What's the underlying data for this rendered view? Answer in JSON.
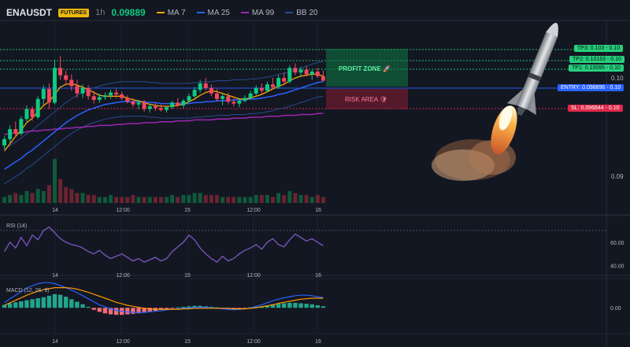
{
  "header": {
    "symbol": "ENAUSDT",
    "market_badge": "FUTURES",
    "timeframe": "1h",
    "last_price": "0.09889",
    "legend": [
      {
        "label": "MA 7",
        "color": "#f7a600"
      },
      {
        "label": "MA 25",
        "color": "#2962ff"
      },
      {
        "label": "MA 99",
        "color": "#9c27b0"
      },
      {
        "label": "BB 20",
        "color": "#2a4a8f"
      }
    ]
  },
  "colors": {
    "up": "#0ecb81",
    "down": "#f6465d",
    "bg": "#131722",
    "tp": "#26d07c",
    "entry": "#2962ff",
    "sl": "#e0294a"
  },
  "zones": {
    "profit_label": "PROFIT ZONE 🚀",
    "risk_label": "RISK AREA 🛡"
  },
  "levels": {
    "tp3": "TP3: 0.103 - 0.10",
    "tp2": "TP2: 0.10163 - 0.10",
    "tp1": "TP1: 0.10095 - 0.10",
    "entry": "ENTRY: 0.098896 - 0.10",
    "sl": "SL: 0.096844 - 0.10"
  },
  "price_axis_labels": [
    "0.10",
    "0.09"
  ],
  "rocket_icon": "rocket-launch",
  "chart_data": [
    {
      "type": "candlestick",
      "x_ticks": [
        "14",
        "12:00",
        "15",
        "12:00",
        "16"
      ],
      "y_ticks": [
        0.09,
        0.1
      ],
      "ylim": [
        0.0855,
        0.1055
      ],
      "candles": [
        [
          0.0918,
          0.0928,
          0.0914,
          0.0925
        ],
        [
          0.0925,
          0.094,
          0.0921,
          0.0936
        ],
        [
          0.0936,
          0.0944,
          0.0927,
          0.0931
        ],
        [
          0.0931,
          0.095,
          0.0929,
          0.0947
        ],
        [
          0.0947,
          0.0962,
          0.0944,
          0.0958
        ],
        [
          0.0958,
          0.0961,
          0.0945,
          0.0949
        ],
        [
          0.0949,
          0.0972,
          0.0947,
          0.0969
        ],
        [
          0.0969,
          0.0984,
          0.0963,
          0.098
        ],
        [
          0.098,
          0.0986,
          0.0958,
          0.0965
        ],
        [
          0.0965,
          0.1012,
          0.0963,
          0.1003
        ],
        [
          0.1003,
          0.1016,
          0.099,
          0.0995
        ],
        [
          0.0995,
          0.1,
          0.0985,
          0.099
        ],
        [
          0.099,
          0.0996,
          0.0978,
          0.0983
        ],
        [
          0.0983,
          0.099,
          0.097,
          0.0975
        ],
        [
          0.0975,
          0.0985,
          0.097,
          0.0981
        ],
        [
          0.0981,
          0.0984,
          0.0968,
          0.0972
        ],
        [
          0.0972,
          0.0978,
          0.0964,
          0.0968
        ],
        [
          0.0968,
          0.0975,
          0.0965,
          0.0971
        ],
        [
          0.0971,
          0.0976,
          0.0968,
          0.0973
        ],
        [
          0.0973,
          0.0979,
          0.0969,
          0.0976
        ],
        [
          0.0976,
          0.098,
          0.097,
          0.0974
        ],
        [
          0.0974,
          0.0977,
          0.0968,
          0.097
        ],
        [
          0.097,
          0.0973,
          0.0964,
          0.0966
        ],
        [
          0.0966,
          0.097,
          0.096,
          0.0963
        ],
        [
          0.0963,
          0.0968,
          0.0958,
          0.0965
        ],
        [
          0.0965,
          0.0968,
          0.0955,
          0.0958
        ],
        [
          0.0958,
          0.0964,
          0.0954,
          0.0961
        ],
        [
          0.0961,
          0.0965,
          0.0956,
          0.0959
        ],
        [
          0.0959,
          0.0963,
          0.0955,
          0.0957
        ],
        [
          0.0957,
          0.0961,
          0.0954,
          0.096
        ],
        [
          0.096,
          0.0967,
          0.0958,
          0.0965
        ],
        [
          0.0965,
          0.097,
          0.096,
          0.0962
        ],
        [
          0.0962,
          0.0969,
          0.0959,
          0.0967
        ],
        [
          0.0967,
          0.0975,
          0.0965,
          0.0972
        ],
        [
          0.0972,
          0.0982,
          0.097,
          0.0979
        ],
        [
          0.0979,
          0.099,
          0.0976,
          0.0986
        ],
        [
          0.0986,
          0.0992,
          0.0978,
          0.0981
        ],
        [
          0.0981,
          0.0985,
          0.0972,
          0.0975
        ],
        [
          0.0975,
          0.098,
          0.0966,
          0.0969
        ],
        [
          0.0969,
          0.0975,
          0.0962,
          0.0972
        ],
        [
          0.0972,
          0.0976,
          0.0963,
          0.0966
        ],
        [
          0.0966,
          0.097,
          0.0961,
          0.0964
        ],
        [
          0.0964,
          0.097,
          0.096,
          0.0967
        ],
        [
          0.0967,
          0.0973,
          0.0965,
          0.097
        ],
        [
          0.097,
          0.0978,
          0.0968,
          0.0975
        ],
        [
          0.0975,
          0.0984,
          0.0973,
          0.0981
        ],
        [
          0.0981,
          0.0986,
          0.0975,
          0.0978
        ],
        [
          0.0978,
          0.0988,
          0.0976,
          0.0985
        ],
        [
          0.0985,
          0.0992,
          0.098,
          0.0982
        ],
        [
          0.0982,
          0.0995,
          0.098,
          0.0992
        ],
        [
          0.0992,
          0.0998,
          0.0985,
          0.0988
        ],
        [
          0.0988,
          0.1006,
          0.0986,
          0.1003
        ],
        [
          0.1003,
          0.1008,
          0.0995,
          0.0998
        ],
        [
          0.0998,
          0.1004,
          0.0993,
          0.1001
        ],
        [
          0.1001,
          0.1005,
          0.0994,
          0.0996
        ],
        [
          0.0996,
          0.1001,
          0.099,
          0.0999
        ],
        [
          0.0999,
          0.1003,
          0.0992,
          0.0994
        ],
        [
          0.0994,
          0.1,
          0.0988,
          0.0989
        ]
      ],
      "ma7": [
        0.0912,
        0.092,
        0.0928,
        0.0935,
        0.0943,
        0.0948,
        0.0955,
        0.0962,
        0.0966,
        0.0974,
        0.0982,
        0.0985,
        0.0986,
        0.0984,
        0.0982,
        0.0979,
        0.0976,
        0.0973,
        0.0972,
        0.0972,
        0.0972,
        0.0972,
        0.097,
        0.0968,
        0.0967,
        0.0965,
        0.0963,
        0.0962,
        0.0961,
        0.0961,
        0.0961,
        0.0962,
        0.0963,
        0.0966,
        0.0969,
        0.0973,
        0.0976,
        0.0978,
        0.0977,
        0.0975,
        0.0973,
        0.0971,
        0.0969,
        0.0969,
        0.097,
        0.0972,
        0.0974,
        0.0977,
        0.098,
        0.0983,
        0.0985,
        0.0989,
        0.0992,
        0.0994,
        0.0995,
        0.0996,
        0.0996,
        0.0994
      ],
      "ma25": [
        0.0892,
        0.0896,
        0.09,
        0.0904,
        0.0909,
        0.0913,
        0.0918,
        0.0923,
        0.0928,
        0.0933,
        0.0938,
        0.0943,
        0.0947,
        0.0951,
        0.0954,
        0.0957,
        0.0959,
        0.0961,
        0.0963,
        0.0964,
        0.0965,
        0.0966,
        0.0966,
        0.0966,
        0.0966,
        0.0966,
        0.0965,
        0.0965,
        0.0964,
        0.0964,
        0.0964,
        0.0964,
        0.0964,
        0.0964,
        0.0965,
        0.0965,
        0.0966,
        0.0966,
        0.0967,
        0.0967,
        0.0967,
        0.0968,
        0.0968,
        0.0968,
        0.0969,
        0.0969,
        0.097,
        0.0971,
        0.0972,
        0.0974,
        0.0975,
        0.0977,
        0.0979,
        0.0981,
        0.0983,
        0.0985,
        0.0987,
        0.0988
      ],
      "ma99": [
        0.093,
        0.0931,
        0.0932,
        0.0932,
        0.0933,
        0.0934,
        0.0934,
        0.0935,
        0.0935,
        0.0936,
        0.0936,
        0.0937,
        0.0937,
        0.0938,
        0.0938,
        0.0939,
        0.0939,
        0.094,
        0.094,
        0.094,
        0.0941,
        0.0941,
        0.0942,
        0.0942,
        0.0942,
        0.0943,
        0.0943,
        0.0943,
        0.0944,
        0.0944,
        0.0944,
        0.0945,
        0.0945,
        0.0945,
        0.0946,
        0.0946,
        0.0946,
        0.0946,
        0.0947,
        0.0947,
        0.0947,
        0.0948,
        0.0948,
        0.0948,
        0.0949,
        0.0949,
        0.0949,
        0.095,
        0.095,
        0.095,
        0.0951,
        0.0951,
        0.0951,
        0.0952,
        0.0952,
        0.0952,
        0.0953,
        0.0953
      ],
      "volume": [
        3,
        4,
        5,
        4,
        6,
        5,
        7,
        6,
        9,
        22,
        12,
        8,
        7,
        5,
        5,
        4,
        4,
        3,
        3,
        4,
        3,
        3,
        3,
        4,
        3,
        3,
        3,
        3,
        3,
        3,
        4,
        3,
        4,
        4,
        5,
        5,
        4,
        4,
        4,
        3,
        3,
        3,
        3,
        3,
        3,
        4,
        4,
        4,
        3,
        5,
        4,
        6,
        5,
        4,
        4,
        3,
        4,
        3
      ]
    },
    {
      "type": "line",
      "name": "RSI (14)",
      "y_ticks": [
        40.0,
        60.0
      ],
      "ylim": [
        35,
        80
      ],
      "values": [
        52,
        60,
        55,
        64,
        57,
        66,
        62,
        70,
        73,
        68,
        63,
        60,
        58,
        57,
        55,
        52,
        50,
        53,
        49,
        46,
        48,
        50,
        47,
        44,
        46,
        43,
        45,
        47,
        44,
        46,
        52,
        56,
        60,
        66,
        62,
        55,
        50,
        46,
        43,
        48,
        44,
        46,
        50,
        53,
        55,
        58,
        54,
        60,
        63,
        58,
        56,
        62,
        67,
        64,
        61,
        63,
        60,
        57
      ]
    },
    {
      "type": "bar",
      "name": "MACD (12, 26, 9)",
      "y_ticks": [
        0.0
      ],
      "ylim": [
        -0.00045,
        0.00055
      ],
      "histogram": [
        6e-05,
        9e-05,
        0.00011,
        0.00013,
        0.00015,
        0.00017,
        0.00019,
        0.00021,
        0.00024,
        0.00027,
        0.00026,
        0.00022,
        0.00017,
        0.00012,
        7e-05,
        2e-05,
        -4e-05,
        -8e-05,
        -0.00011,
        -0.00013,
        -0.00014,
        -0.00014,
        -0.00013,
        -0.00012,
        -0.00011,
        -0.0001,
        -8e-05,
        -6e-05,
        -4e-05,
        -2e-05,
        -1e-05,
        1e-05,
        2e-05,
        3e-05,
        4e-05,
        4e-05,
        3e-05,
        2e-05,
        1e-05,
        -1e-05,
        -2e-05,
        -3e-05,
        -2e-05,
        -1e-05,
        1e-05,
        2e-05,
        3e-05,
        5e-05,
        7e-05,
        8e-05,
        9e-05,
        0.0001,
        0.0001,
        9e-05,
        8e-05,
        7e-05,
        5e-05,
        3e-05
      ],
      "macd": [
        0.0001,
        0.00018,
        0.00025,
        0.00032,
        0.00039,
        0.00044,
        0.00048,
        0.0005,
        0.0005,
        0.00048,
        0.00044,
        0.0004,
        0.00035,
        0.0003,
        0.00024,
        0.00018,
        0.00012,
        6e-05,
        2e-05,
        -2e-05,
        -5e-05,
        -7e-05,
        -8e-05,
        -9e-05,
        -9e-05,
        -9e-05,
        -8e-05,
        -7e-05,
        -6e-05,
        -4e-05,
        -3e-05,
        -2e-05,
        -1e-05,
        0.0,
        1e-05,
        1e-05,
        1e-05,
        0.0,
        -1e-05,
        -2e-05,
        -3e-05,
        -4e-05,
        -3e-05,
        -2e-05,
        0.0,
        3e-05,
        6e-05,
        0.0001,
        0.00014,
        0.00017,
        0.0002,
        0.00022,
        0.00024,
        0.00025,
        0.00025,
        0.00024,
        0.00022,
        0.0002
      ],
      "signal": [
        5e-05,
        0.0001,
        0.00015,
        0.0002,
        0.00025,
        0.00029,
        0.00033,
        0.00036,
        0.00038,
        0.0004,
        0.0004,
        0.0004,
        0.00039,
        0.00037,
        0.00034,
        0.00031,
        0.00027,
        0.00023,
        0.00019,
        0.00015,
        0.00011,
        8e-05,
        5e-05,
        3e-05,
        1e-05,
        -1e-05,
        -2e-05,
        -3e-05,
        -3e-05,
        -3e-05,
        -3e-05,
        -3e-05,
        -2e-05,
        -2e-05,
        -1e-05,
        -1e-05,
        -1e-05,
        -1e-05,
        -1e-05,
        -1e-05,
        -1e-05,
        -2e-05,
        -2e-05,
        -2e-05,
        -1e-05,
        0.0,
        2e-05,
        4e-05,
        6e-05,
        9e-05,
        0.00011,
        0.00013,
        0.00015,
        0.00017,
        0.00018,
        0.00019,
        0.00019,
        0.00019
      ]
    }
  ]
}
